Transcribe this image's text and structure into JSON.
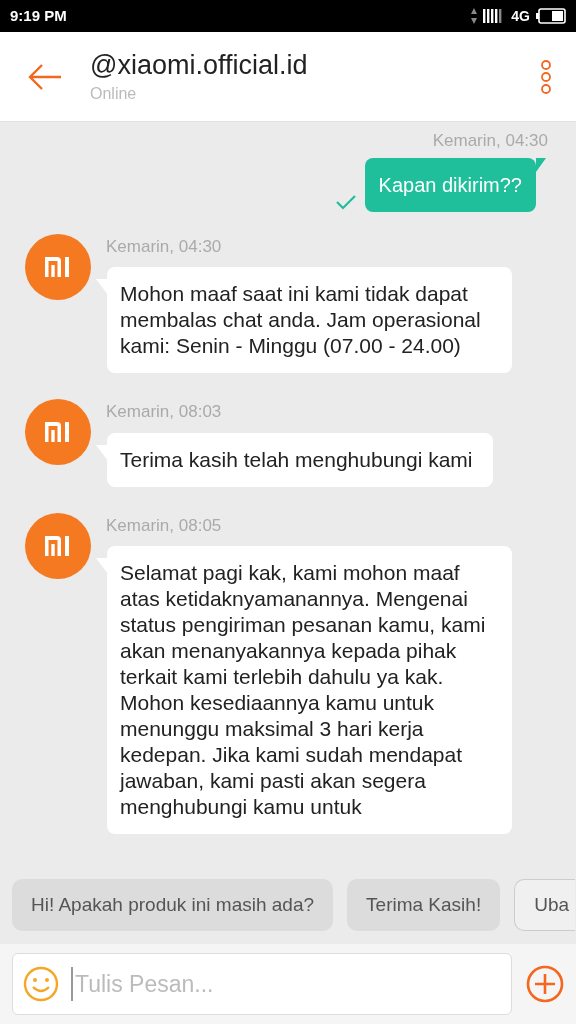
{
  "status_bar": {
    "time": "9:19 PM",
    "network": "4G"
  },
  "header": {
    "title": "@xiaomi.official.id",
    "subtitle": "Online"
  },
  "messages": [
    {
      "kind": "outgoing",
      "time": "Kemarin, 04:30",
      "text": "Kapan dikirim??",
      "delivered": true
    },
    {
      "kind": "incoming",
      "time": "Kemarin, 04:30",
      "text": "Mohon maaf saat ini kami tidak dapat membalas chat anda. Jam operasional kami: Senin - Minggu (07.00 - 24.00)"
    },
    {
      "kind": "incoming",
      "time": "Kemarin, 08:03",
      "text": "Terima kasih telah menghubungi kami"
    },
    {
      "kind": "incoming",
      "time": "Kemarin, 08:05",
      "text": "Selamat pagi kak, kami mohon maaf atas ketidaknyamanannya. Mengenai status pengiriman pesanan kamu, kami akan menanyakannya kepada pihak terkait kami terlebih dahulu ya kak. Mohon kesediaannya kamu untuk menunggu maksimal 3 hari kerja kedepan. Jika kami sudah mendapat jawaban, kami pasti akan segera menghubungi kamu untuk"
    }
  ],
  "quick_replies": [
    {
      "kind": "filled",
      "label": "Hi! Apakah produk ini masih ada?"
    },
    {
      "kind": "filled",
      "label": "Terima Kasih!"
    },
    {
      "kind": "outlined",
      "label": "Uba"
    }
  ],
  "composer": {
    "placeholder": "Tulis Pesan..."
  }
}
